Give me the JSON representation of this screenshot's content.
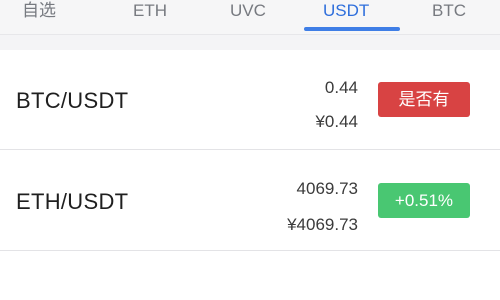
{
  "tabs": [
    {
      "label": "自选",
      "active": false
    },
    {
      "label": "ETH",
      "active": false
    },
    {
      "label": "UVC",
      "active": false
    },
    {
      "label": "USDT",
      "active": true
    },
    {
      "label": "BTC",
      "active": false
    }
  ],
  "colors": {
    "active_tab": "#2f6fdc",
    "down": "#d84343",
    "up": "#49c772"
  },
  "markets": [
    {
      "pair": "BTC/USDT",
      "price": "0.44",
      "cny_price": "¥0.44",
      "change": "是否有",
      "direction": "down"
    },
    {
      "pair": "ETH/USDT",
      "price": "4069.73",
      "cny_price": "¥4069.73",
      "change": "+0.51%",
      "direction": "up"
    }
  ]
}
